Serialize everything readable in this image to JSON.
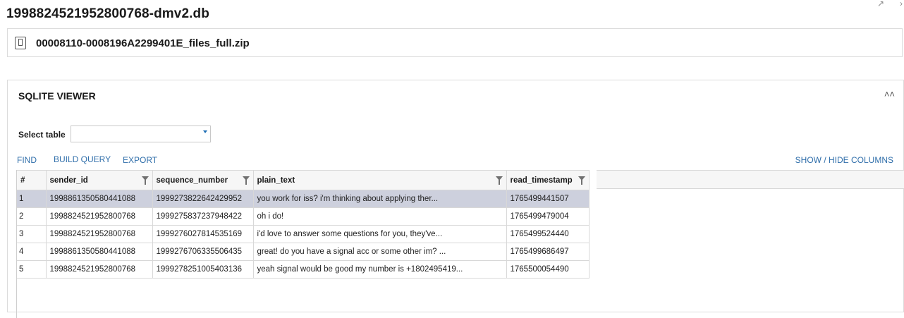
{
  "header": {
    "title": "1998824521952800768-dmv2.db",
    "pin_icon": "pin-icon",
    "close_icon": "close-icon"
  },
  "file": {
    "icon": "phone-icon",
    "name": "00008110-0008196A2299401E_files_full.zip"
  },
  "viewer": {
    "title": "SQLITE VIEWER",
    "collapse_icon": "double-chevron-up-icon",
    "select_label": "Select table",
    "select_value": "",
    "toolbar": {
      "find": "FIND",
      "build_query": "BUILD QUERY",
      "export": "EXPORT",
      "show_hide_columns": "SHOW / HIDE COLUMNS"
    },
    "columns": [
      "#",
      "sender_id",
      "sequence_number",
      "plain_text",
      "read_timestamp"
    ],
    "rows": [
      [
        "1",
        "1998861350580441088",
        "1999273822642429952",
        "you work for iss? i'm thinking about applying ther...",
        "1765499441507"
      ],
      [
        "2",
        "1998824521952800768",
        "1999275837237948422",
        "oh i do!",
        "1765499479004"
      ],
      [
        "3",
        "1998824521952800768",
        "1999276027814535169",
        "i'd love to answer some questions for you, they've...",
        "1765499524440"
      ],
      [
        "4",
        "1998861350580441088",
        "1999276706335506435",
        "great! do you have a signal acc or some other im? ...",
        "1765499686497"
      ],
      [
        "5",
        "1998824521952800768",
        "1999278251005403136",
        "yeah signal would be good my number is +1802495419...",
        "1765500054490"
      ]
    ],
    "selected_row": 1,
    "colors": {
      "link": "#2f6eaa",
      "selected_row": "#cdd0dd",
      "accent_arrow": "#1f6fb5"
    }
  }
}
